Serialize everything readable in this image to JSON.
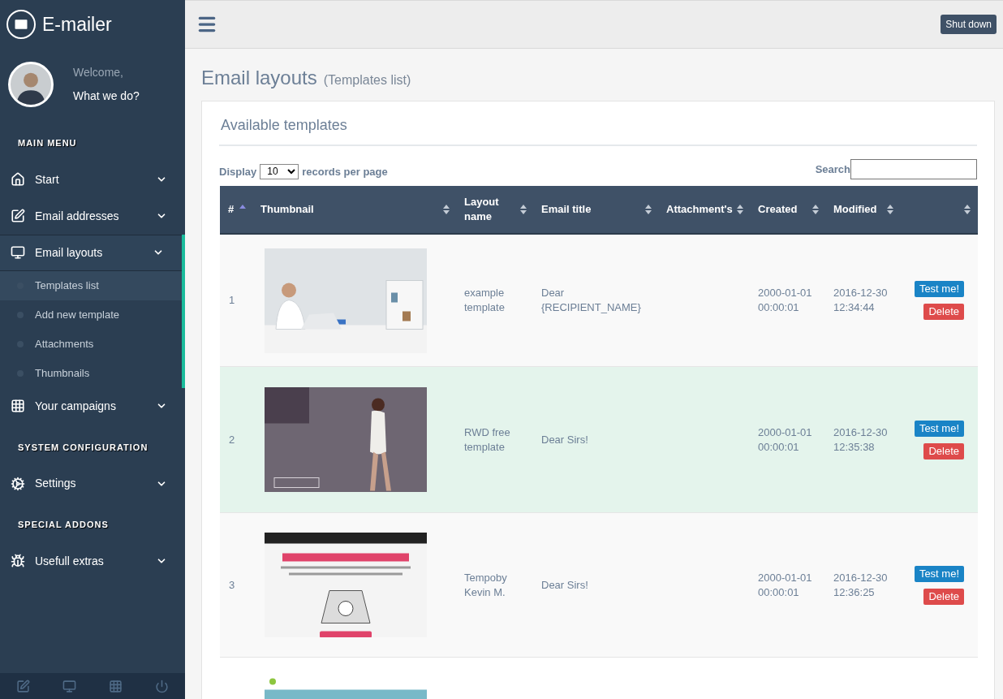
{
  "brand": {
    "name": "E-mailer"
  },
  "user": {
    "greeting": "Welcome,",
    "link": "What we do?"
  },
  "sidebar": {
    "sections": [
      {
        "title": "MAIN MENU",
        "items": [
          {
            "label": "Start",
            "expanded": false
          },
          {
            "label": "Email addresses",
            "expanded": false
          },
          {
            "label": "Email layouts",
            "expanded": true,
            "children": [
              {
                "label": "Templates list",
                "selected": true
              },
              {
                "label": "Add new template",
                "selected": false
              },
              {
                "label": "Attachments",
                "selected": false
              },
              {
                "label": "Thumbnails",
                "selected": false
              }
            ]
          },
          {
            "label": "Your campaigns",
            "expanded": false
          }
        ]
      },
      {
        "title": "SYSTEM CONFIGURATION",
        "items": [
          {
            "label": "Settings",
            "expanded": false
          }
        ]
      },
      {
        "title": "SPECIAL ADDONS",
        "items": [
          {
            "label": "Usefull extras",
            "expanded": false
          }
        ]
      }
    ]
  },
  "header": {
    "button": "Shut down"
  },
  "page": {
    "title": "Email layouts",
    "subtitle": "(Templates list)"
  },
  "panel": {
    "title": "Available templates",
    "length": {
      "before": "Display",
      "value": "10",
      "after": "records per page"
    },
    "search": {
      "label": "Search"
    },
    "table": {
      "columns": [
        {
          "label": "#",
          "sorted": true
        },
        {
          "label": "Thumbnail",
          "sorted": false
        },
        {
          "label": "Layout name",
          "sorted": false
        },
        {
          "label": "Email title",
          "sorted": false
        },
        {
          "label": "Attachment's",
          "sorted": false
        },
        {
          "label": "Created",
          "sorted": false
        },
        {
          "label": "Modified",
          "sorted": false
        },
        {
          "sorted": false
        }
      ],
      "rows": [
        {
          "index": "1",
          "thumbnail": {
            "kind": "picture"
          },
          "layout_name": "example template",
          "email_title": "Dear {RECIPIENT_NAME}",
          "created": "2000-01-01 00:00:01",
          "modified": "2016-12-30 12:34:44",
          "highlighted": false,
          "actions": [
            "Test me!",
            "Delete"
          ]
        },
        {
          "index": "2",
          "thumbnail": {
            "kind": "picture"
          },
          "layout_name": "RWD free template",
          "email_title": "Dear Sirs!",
          "created": "2000-01-01 00:00:01",
          "modified": "2016-12-30 12:35:38",
          "highlighted": true,
          "actions": [
            "Test me!",
            "Delete"
          ]
        },
        {
          "index": "3",
          "thumbnail": {
            "kind": "picture"
          },
          "layout_name": "Tempoby Kevin M.",
          "email_title": "Dear Sirs!",
          "created": "2000-01-01 00:00:01",
          "modified": "2016-12-30 12:36:25",
          "highlighted": false,
          "actions": [
            "Test me!",
            "Delete"
          ]
        },
        {
          "thumbnail": {
            "kind": "picture"
          },
          "highlighted": false
        }
      ]
    }
  }
}
